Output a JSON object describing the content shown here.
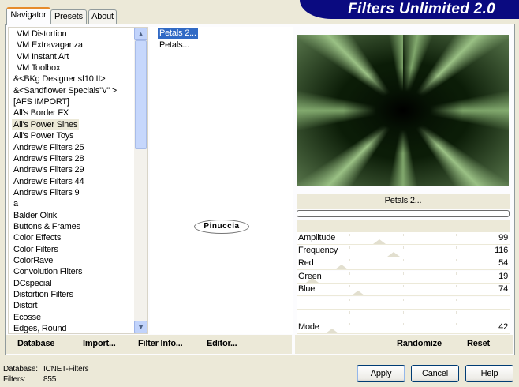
{
  "title": "Filters Unlimited 2.0",
  "tabs": [
    {
      "label": "Navigator",
      "active": true
    },
    {
      "label": "Presets"
    },
    {
      "label": "About"
    }
  ],
  "categories": [
    "VM Distortion",
    "VM Extravaganza",
    "VM Instant Art",
    "VM Toolbox",
    "&<BKg Designer sf10 II>",
    "&<Sandflower Specials\"v\" >",
    "[AFS IMPORT]",
    "All's Border FX",
    "All's Power Sines",
    "All's Power Toys",
    "Andrew's Filters 25",
    "Andrew's Filters 28",
    "Andrew's Filters 29",
    "Andrew's Filters 44",
    "Andrew's Filters 9",
    "a",
    "Balder Olrik",
    "Buttons & Frames",
    "Color Effects",
    "Color Filters",
    "ColorRave",
    "Convolution Filters",
    "DCspecial",
    "Distortion Filters",
    "Distort",
    "Ecosse",
    "Edges, Round"
  ],
  "selected_category": "All's Power Sines",
  "filters": [
    "Petals 2...",
    "Petals..."
  ],
  "selected_filter": "Petals 2...",
  "watermark": "Pinuccia",
  "filter_name": "Petals 2...",
  "progress": 0,
  "sliders": [
    {
      "label": "Amplitude",
      "value": "99",
      "fraction": 0.388
    },
    {
      "label": "Frequency",
      "value": "116",
      "fraction": 0.455
    },
    {
      "label": "Red",
      "value": "54",
      "fraction": 0.212
    },
    {
      "label": "Green",
      "value": "19",
      "fraction": 0.075
    },
    {
      "label": "Blue",
      "value": "74",
      "fraction": 0.29
    },
    {
      "label": "",
      "value": ""
    },
    {
      "label": "",
      "value": ""
    },
    {
      "label": "Mode",
      "value": "42",
      "fraction": 0.165
    }
  ],
  "buttons": {
    "database": "Database",
    "import": "Import...",
    "filter_info": "Filter Info...",
    "editor": "Editor...",
    "randomize": "Randomize",
    "reset": "Reset",
    "apply": "Apply",
    "cancel": "Cancel",
    "help": "Help"
  },
  "status": {
    "database_label": "Database:",
    "database_value": "ICNET-Filters",
    "filters_label": "Filters:",
    "filters_value": "855"
  },
  "colors": {
    "banner": "#0a0a80",
    "selection": "#316ac5",
    "tab_accent": "#e68b2c"
  }
}
